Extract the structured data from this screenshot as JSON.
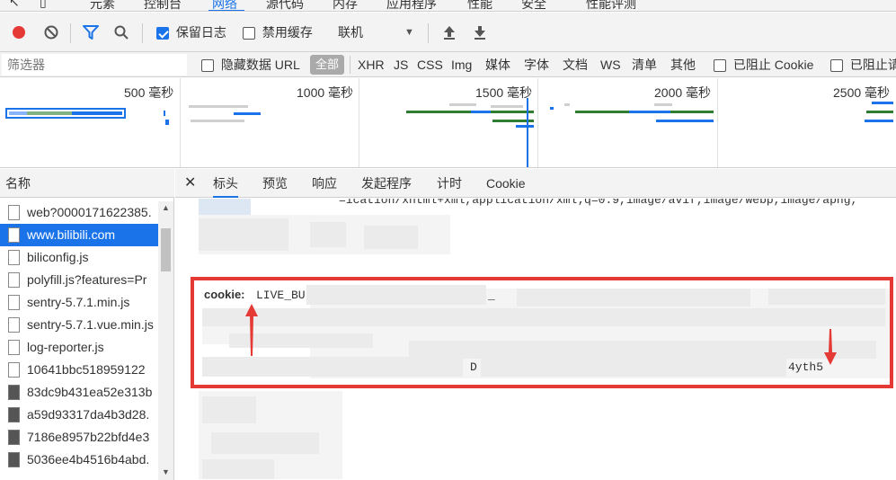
{
  "top_tabs": [
    "元素",
    "控制台",
    "网络",
    "源代码",
    "内存",
    "应用程序",
    "性能",
    "安全",
    "性能评测"
  ],
  "active_top_tab": "网络",
  "toolbar": {
    "preserve_log": "保留日志",
    "disable_cache": "禁用缓存",
    "throttling": "联机"
  },
  "filter": {
    "placeholder": "筛选器",
    "hide_data_url": "隐藏数据 URL",
    "all": "全部",
    "types": [
      "XHR",
      "JS",
      "CSS",
      "Img",
      "媒体",
      "字体",
      "文档",
      "WS",
      "清单",
      "其他"
    ],
    "blocked_cookie": "已阻止 Cookie",
    "blocked_request": "已阻止请"
  },
  "overview": {
    "ticks": [
      "500 毫秒",
      "1000 毫秒",
      "1500 毫秒",
      "2000 毫秒",
      "2500 毫秒"
    ]
  },
  "request_list": {
    "header": "名称",
    "items": [
      {
        "name": "web?0000171622385."
      },
      {
        "name": "www.bilibili.com"
      },
      {
        "name": "biliconfig.js"
      },
      {
        "name": "polyfill.js?features=Pr"
      },
      {
        "name": "sentry-5.7.1.min.js"
      },
      {
        "name": "sentry-5.7.1.vue.min.js"
      },
      {
        "name": "log-reporter.js"
      },
      {
        "name": "10641bbc518959122"
      },
      {
        "name": "83dc9b431ea52e313b"
      },
      {
        "name": "a59d93317da4b3d28."
      },
      {
        "name": "7186e8957b22bfd4e3"
      },
      {
        "name": "5036ee4b4516b4abd."
      }
    ]
  },
  "detail_tabs": [
    "标头",
    "预览",
    "响应",
    "发起程序",
    "计时",
    "Cookie"
  ],
  "detail": {
    "accept_fragment": "=ication/xhtml+xml,application/xml;q=0.9,image/avif,image/webp,image/apng,",
    "cookie_key": "cookie:",
    "cookie_start": "LIVE_BU",
    "cookie_mid": "_",
    "cookie_d": "D",
    "cookie_end": "4yth5"
  },
  "colors": {
    "accent": "#1a73e8",
    "record": "#e53935",
    "annotation": "#e53935"
  }
}
